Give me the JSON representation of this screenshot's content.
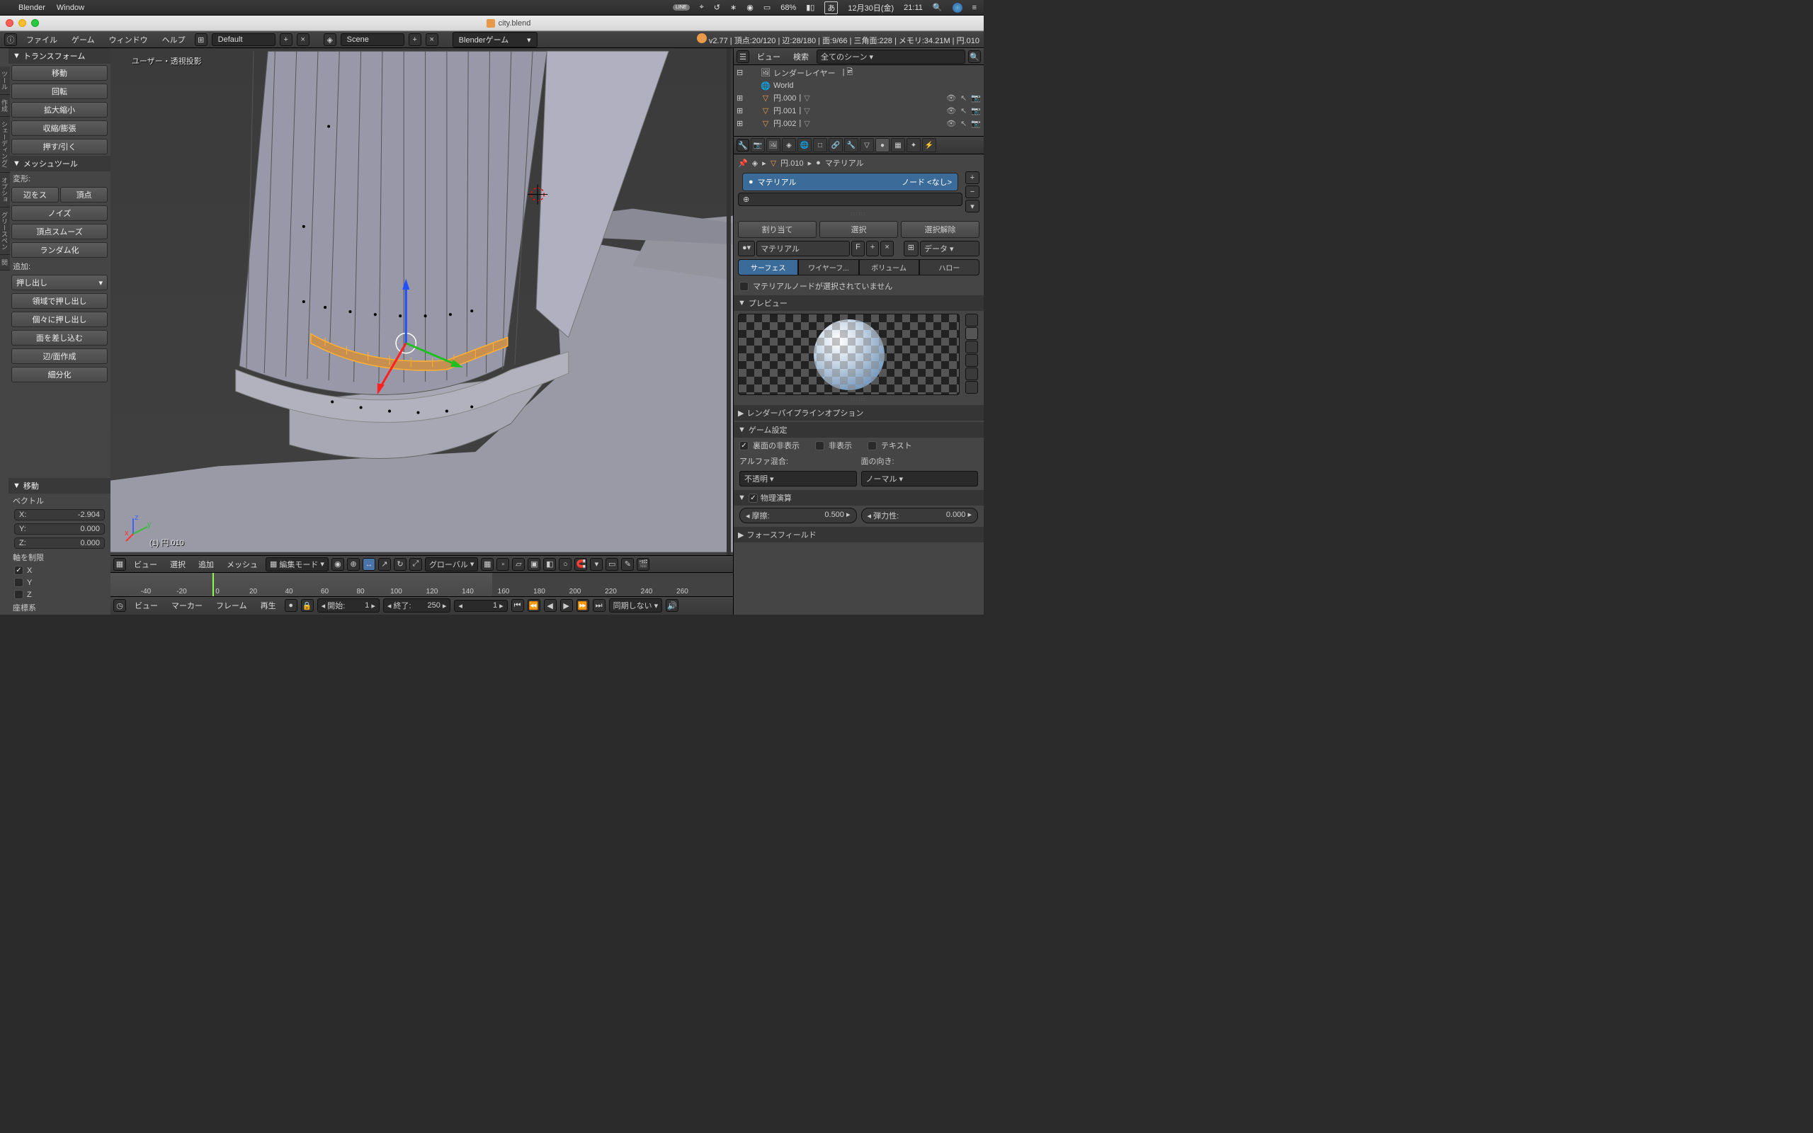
{
  "macos": {
    "app": "Blender",
    "menus": [
      "Window"
    ],
    "status": {
      "battery": "68%",
      "input": "あ",
      "date": "12月30日(金)",
      "time": "21:11"
    }
  },
  "window": {
    "title": "city.blend"
  },
  "header": {
    "menus": {
      "file": "ファイル",
      "game": "ゲーム",
      "window": "ウィンドウ",
      "help": "ヘルプ"
    },
    "layout": "Default",
    "scene_label": "Scene",
    "engine": "Blenderゲーム",
    "version": "v2.77",
    "stats": "頂点:20/120 | 辺:28/180 | 面:9/66 | 三角面:228 | メモリ:34.21M | 円.010"
  },
  "tools": {
    "transform_header": "トランスフォーム",
    "transform": {
      "translate": "移動",
      "rotate": "回転",
      "scale": "拡大縮小",
      "shrink": "収縮/膨張",
      "push": "押す/引く"
    },
    "mesh_tools_header": "メッシュツール",
    "deform_label": "変形:",
    "deform": {
      "edge_slide": "辺をス",
      "vertex": "頂点",
      "noise": "ノイズ",
      "smooth_vertex": "頂点スムーズ",
      "randomize": "ランダム化"
    },
    "add_label": "追加:",
    "add": {
      "extrude": "押し出し",
      "extrude_region": "領域で押し出し",
      "extrude_individual": "個々に押し出し",
      "inset": "面を差し込む",
      "make_edge": "辺/面作成",
      "subdivide": "細分化"
    },
    "last_op_header": "移動",
    "vector_label": "ベクトル",
    "vec": {
      "x_label": "X:",
      "x": "-2.904",
      "y_label": "Y:",
      "y": "0.000",
      "z_label": "Z:",
      "z": "0.000"
    },
    "constraint_label": "軸を制限",
    "ax": {
      "x": "X",
      "y": "Y",
      "z": "Z"
    },
    "orientation_label": "座標系"
  },
  "viewport": {
    "overlay_text": "ユーザー・透視投影",
    "object_name": "(1) 円.010",
    "header": {
      "view": "ビュー",
      "select": "選択",
      "add": "追加",
      "mesh": "メッシュ",
      "mode": "編集モード",
      "orientation": "グローバル"
    }
  },
  "timeline": {
    "ticks": [
      "-40",
      "-20",
      "0",
      "20",
      "40",
      "60",
      "80",
      "100",
      "120",
      "140",
      "160",
      "180",
      "200",
      "220",
      "240",
      "260"
    ],
    "header": {
      "view": "ビュー",
      "marker": "マーカー",
      "frame": "フレーム",
      "playback": "再生",
      "start_label": "開始:",
      "start": "1",
      "end_label": "終了:",
      "end": "250",
      "current": "1",
      "sync": "同期しない"
    }
  },
  "outliner": {
    "header": {
      "view": "ビュー",
      "search": "検索",
      "filter": "全てのシーン"
    },
    "items": [
      {
        "label": "レンダーレイヤー"
      },
      {
        "label": "World"
      },
      {
        "label": "円.000"
      },
      {
        "label": "円.001"
      },
      {
        "label": "円.002"
      }
    ]
  },
  "properties": {
    "breadcrumb": {
      "obj": "円.010",
      "mat": "マテリアル"
    },
    "material_slot": {
      "name": "マテリアル",
      "nodes": "ノード <なし>"
    },
    "buttons": {
      "assign": "割り当て",
      "select": "選択",
      "deselect": "選択解除"
    },
    "material_name": "マテリアル",
    "f_label": "F",
    "data_label": "データ",
    "type_tabs": {
      "surface": "サーフェス",
      "wire": "ワイヤーフ...",
      "volume": "ボリューム",
      "halo": "ハロー"
    },
    "node_warning": "マテリアルノードが選択されていません",
    "preview_header": "プレビュー",
    "pipeline_header": "レンダーパイプラインオプション",
    "game_header": "ゲーム設定",
    "game": {
      "backface": "裏面の非表示",
      "invisible": "非表示",
      "text": "テキスト",
      "alpha_label": "アルファ混合:",
      "face_label": "面の向き:",
      "alpha_value": "不透明",
      "face_value": "ノーマル"
    },
    "physics_header": "物理演算",
    "physics": {
      "friction_label": "摩擦:",
      "friction": "0.500",
      "elastic_label": "弾力性:",
      "elastic": "0.000"
    },
    "forcefield_header": "フォースフィールド"
  }
}
